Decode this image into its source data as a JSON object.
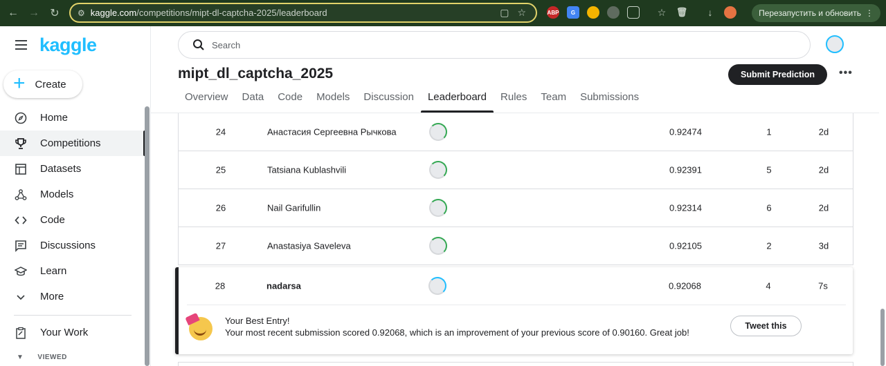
{
  "browser": {
    "url_host": "kaggle.com",
    "url_path": "/competitions/mipt-dl-captcha-2025/leaderboard",
    "relaunch_label": "Перезапустить и обновить",
    "ext_abp": "ABP"
  },
  "sidebar": {
    "logo": "kaggle",
    "create_label": "Create",
    "items": [
      {
        "label": "Home",
        "icon": "compass-icon"
      },
      {
        "label": "Competitions",
        "icon": "trophy-icon",
        "active": true
      },
      {
        "label": "Datasets",
        "icon": "table-icon"
      },
      {
        "label": "Models",
        "icon": "models-icon"
      },
      {
        "label": "Code",
        "icon": "code-icon"
      },
      {
        "label": "Discussions",
        "icon": "comments-icon"
      },
      {
        "label": "Learn",
        "icon": "school-icon"
      },
      {
        "label": "More",
        "icon": "chevron-down-icon"
      }
    ],
    "your_work": "Your Work",
    "viewed": "VIEWED"
  },
  "header": {
    "search_placeholder": "Search",
    "title": "mipt_dl_captcha_2025",
    "submit_label": "Submit Prediction",
    "more_label": "•••",
    "tabs": [
      {
        "label": "Overview"
      },
      {
        "label": "Data"
      },
      {
        "label": "Code"
      },
      {
        "label": "Models"
      },
      {
        "label": "Discussion"
      },
      {
        "label": "Leaderboard",
        "active": true
      },
      {
        "label": "Rules"
      },
      {
        "label": "Team"
      },
      {
        "label": "Submissions"
      }
    ]
  },
  "leaderboard": {
    "rows": [
      {
        "rank": "24",
        "name": "Анастасия Сергеевна Рычкова",
        "score": "0.92474",
        "entries": "1",
        "last": "2d"
      },
      {
        "rank": "25",
        "name": "Tatsiana Kublashvili",
        "score": "0.92391",
        "entries": "5",
        "last": "2d"
      },
      {
        "rank": "26",
        "name": "Nail Garifullin",
        "score": "0.92314",
        "entries": "6",
        "last": "2d"
      },
      {
        "rank": "27",
        "name": "Anastasiya Saveleva",
        "score": "0.92105",
        "entries": "2",
        "last": "3d"
      }
    ],
    "my_row": {
      "rank": "28",
      "name": "nadarsa",
      "score": "0.92068",
      "entries": "4",
      "last": "7s"
    },
    "best_entry_title": "Your Best Entry!",
    "best_entry_message": "Your most recent submission scored 0.92068, which is an improvement of your previous score of 0.90160. Great job!",
    "tweet_label": "Tweet this"
  }
}
